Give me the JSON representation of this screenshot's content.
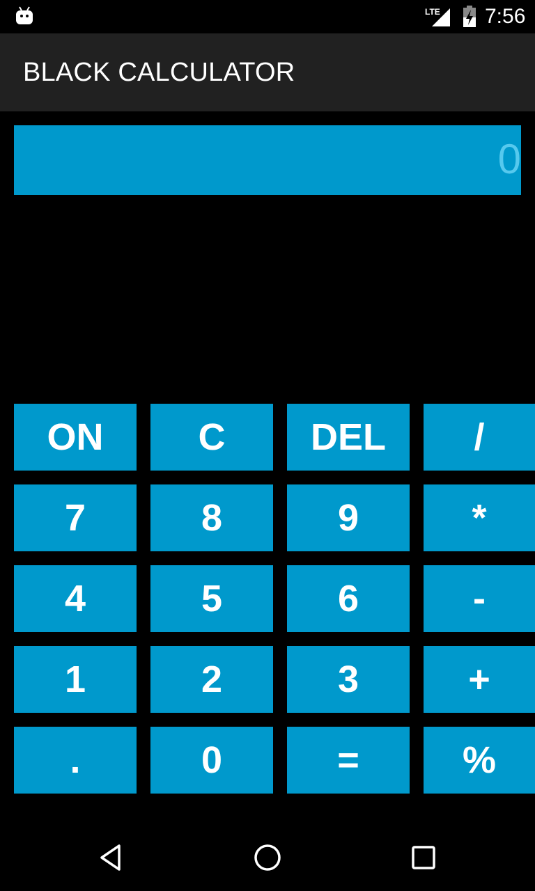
{
  "status_bar": {
    "time": "7:56",
    "network_label": "LTE",
    "icons": [
      "android-debug-icon",
      "lte-signal-icon",
      "battery-charging-icon"
    ]
  },
  "app_bar": {
    "title": "BLACK CALCULATOR"
  },
  "display": {
    "value": "0"
  },
  "keypad": {
    "rows": [
      [
        "ON",
        "C",
        "DEL",
        "/"
      ],
      [
        "7",
        "8",
        "9",
        "*"
      ],
      [
        "4",
        "5",
        "6",
        "-"
      ],
      [
        "1",
        "2",
        "3",
        "+"
      ],
      [
        ".",
        "0",
        "=",
        "%"
      ]
    ]
  },
  "nav_bar": {
    "icons": [
      "back-icon",
      "home-icon",
      "recents-icon"
    ]
  },
  "colors": {
    "background": "#000000",
    "app_bar": "#212121",
    "accent": "#0099cc",
    "display_text": "#56c9ee",
    "key_text": "#ffffff"
  }
}
